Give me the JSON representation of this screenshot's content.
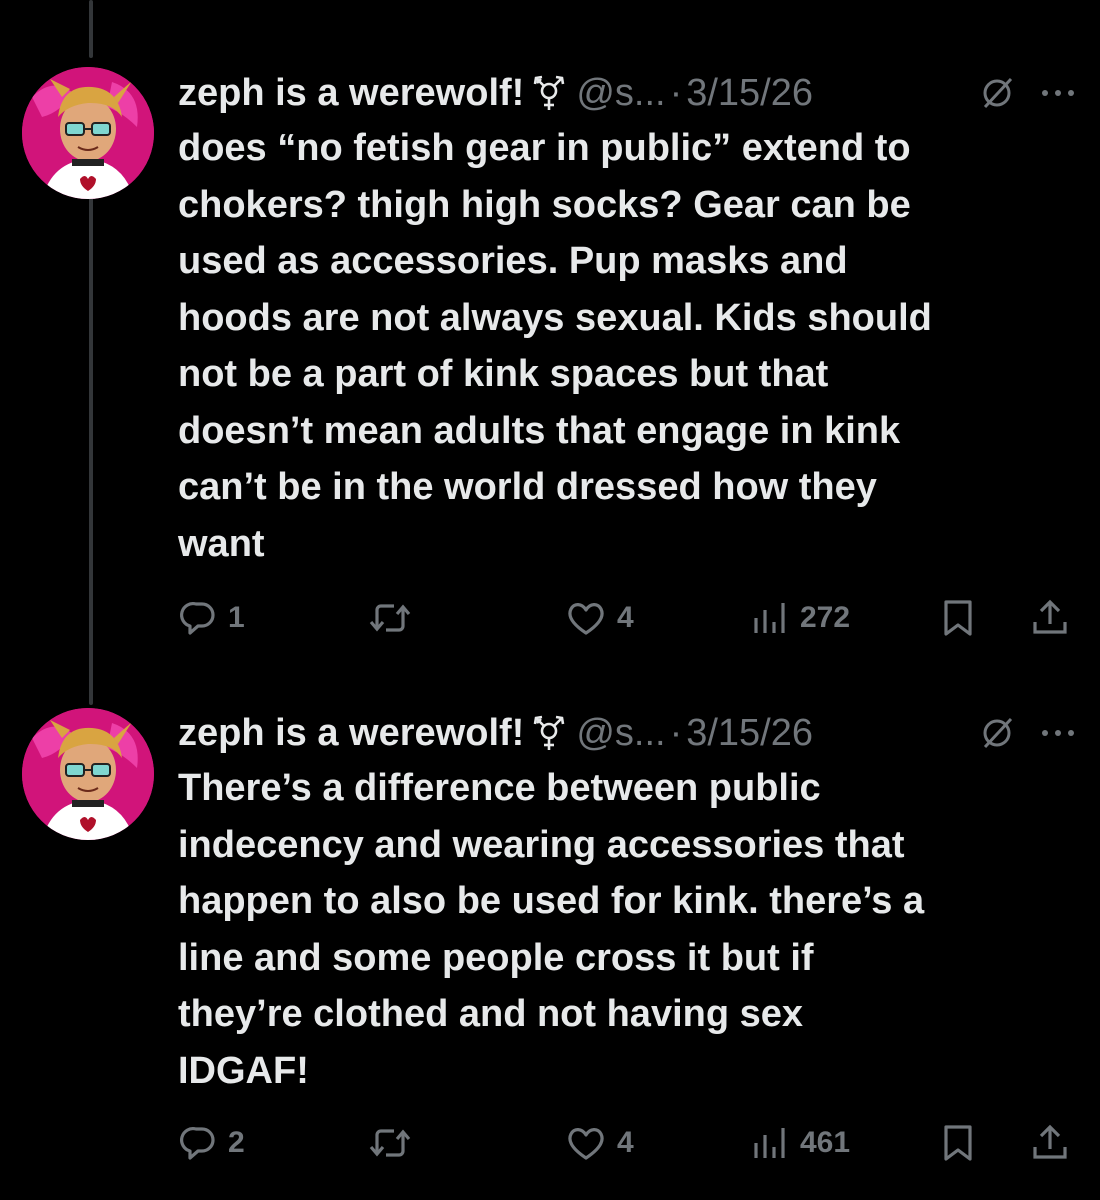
{
  "colors": {
    "background": "#000000",
    "text_primary": "#e7e9ea",
    "text_secondary": "#71767b",
    "thread_line": "#333639",
    "avatar_bg": "#ff3aa8"
  },
  "tweets": [
    {
      "display_name": "zeph is a werewolf!",
      "gender_icon": "transgender-symbol-icon",
      "handle": "@s...",
      "separator": "·",
      "date": "3/15/26",
      "text": "does “no fetish gear in public” extend to\nchokers? thigh high socks? Gear can be\nused as accessories. Pup masks and\nhoods are not always sexual. Kids should\nnot be a part of kink spaces but that\ndoesn’t mean adults that engage in kink\ncan’t be in the world dressed how they\nwant",
      "replies": "1",
      "reposts": "",
      "likes": "4",
      "views": "272"
    },
    {
      "display_name": "zeph is a werewolf!",
      "gender_icon": "transgender-symbol-icon",
      "handle": "@s...",
      "separator": "·",
      "date": "3/15/26",
      "text": "There’s a difference between public\nindecency and wearing accessories that\nhappen to also be used for kink. there’s a\nline and some people cross it but if\nthey’re clothed and not having sex\nIDGAF!",
      "replies": "2",
      "reposts": "",
      "likes": "4",
      "views": "461"
    }
  ]
}
